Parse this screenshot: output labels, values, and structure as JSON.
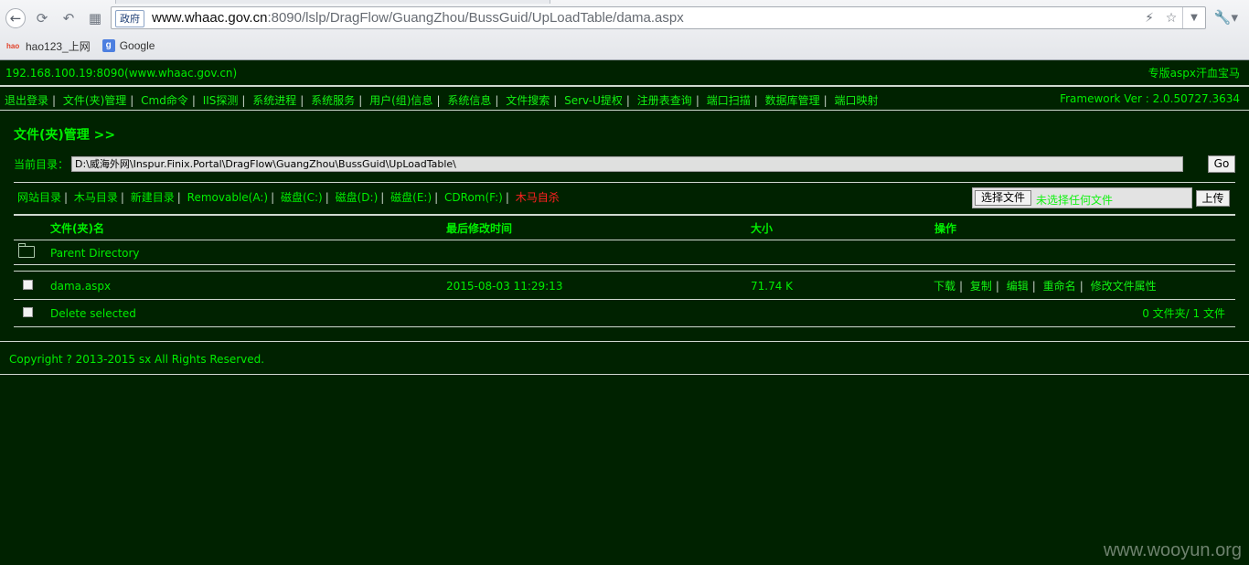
{
  "browser": {
    "gov_badge": "政府",
    "url_host": "www.whaac.gov.cn",
    "url_rest": ":8090/lslp/DragFlow/GuangZhou/BussGuid/UpLoadTable/dama.aspx",
    "bookmarks": [
      {
        "label": "hao123_上网",
        "icon": "hao123-icon"
      },
      {
        "label": "Google",
        "icon": "google-icon"
      }
    ]
  },
  "header": {
    "host_info": "192.168.100.19:8090(www.whaac.gov.cn)",
    "brand": "专版aspx汗血宝马",
    "framework": "Framework Ver : 2.0.50727.3634"
  },
  "nav": [
    "退出登录",
    "文件(夹)管理",
    "Cmd命令",
    "IIS探测",
    "系统进程",
    "系统服务",
    "用户(组)信息",
    "系统信息",
    "文件搜索",
    "Serv-U提权",
    "注册表查询",
    "端口扫描",
    "数据库管理",
    "端口映射"
  ],
  "section_title": "文件(夹)管理 >>",
  "dir": {
    "label": "当前目录：",
    "value": "D:\\威海外网\\Inspur.Finix.Portal\\DragFlow\\GuangZhou\\BussGuid\\UpLoadTable\\",
    "go": "Go"
  },
  "quick_links": [
    "网站目录",
    "木马目录",
    "新建目录",
    "Removable(A:)",
    "磁盘(C:)",
    "磁盘(D:)",
    "磁盘(E:)",
    "CDRom(F:)"
  ],
  "quick_danger": "木马自杀",
  "upload": {
    "choose": "选择文件",
    "nofile": "未选择任何文件",
    "submit": "上传"
  },
  "table": {
    "headers": [
      "文件(夹)名",
      "最后修改时间",
      "大小",
      "操作"
    ],
    "parent": "Parent Directory",
    "file": {
      "name": "dama.aspx",
      "modified": "2015-08-03 11:29:13",
      "size": "71.74 K"
    },
    "ops": [
      "下载",
      "复制",
      "编辑",
      "重命名",
      "修改文件属性"
    ],
    "delete_label": "Delete selected",
    "summary": "0 文件夹/ 1 文件"
  },
  "footer": "Copyright ? 2013-2015 sx All Rights Reserved.",
  "watermark": "www.wooyun.org"
}
